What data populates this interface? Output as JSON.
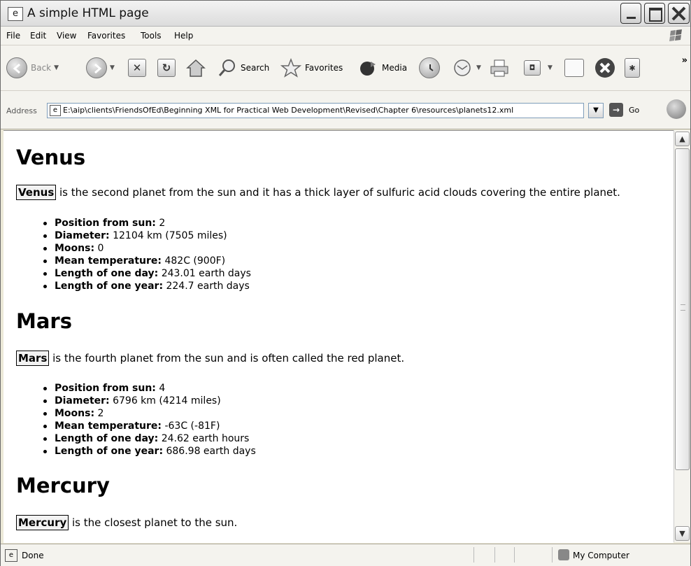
{
  "window": {
    "title": "A simple HTML page"
  },
  "menu": [
    "File",
    "Edit",
    "View",
    "Favorites",
    "Tools",
    "Help"
  ],
  "toolbar": {
    "back": "Back",
    "search": "Search",
    "favorites": "Favorites",
    "media": "Media"
  },
  "address": {
    "label": "Address",
    "url": "E:\\aip\\clients\\FriendsOfEd\\Beginning XML for Practical Web Development\\Revised\\Chapter 6\\resources\\planets12.xml",
    "go": "Go"
  },
  "planets": [
    {
      "heading": "Venus",
      "name": "Venus",
      "description": " is the second planet from the sun and it has a thick layer of sulfuric acid clouds covering the entire planet.",
      "facts": [
        {
          "label": "Position from sun:",
          "value": " 2"
        },
        {
          "label": "Diameter:",
          "value": " 12104 km (7505 miles)"
        },
        {
          "label": "Moons:",
          "value": " 0"
        },
        {
          "label": "Mean temperature:",
          "value": " 482C (900F)"
        },
        {
          "label": "Length of one day:",
          "value": " 243.01 earth days"
        },
        {
          "label": "Length of one year:",
          "value": " 224.7 earth days"
        }
      ]
    },
    {
      "heading": "Mars",
      "name": "Mars",
      "description": " is the fourth planet from the sun and is often called the red planet.",
      "facts": [
        {
          "label": "Position from sun:",
          "value": " 4"
        },
        {
          "label": "Diameter:",
          "value": " 6796 km (4214 miles)"
        },
        {
          "label": "Moons:",
          "value": " 2"
        },
        {
          "label": "Mean temperature:",
          "value": " -63C (-81F)"
        },
        {
          "label": "Length of one day:",
          "value": " 24.62 earth hours"
        },
        {
          "label": "Length of one year:",
          "value": " 686.98 earth days"
        }
      ]
    },
    {
      "heading": "Mercury",
      "name": "Mercury",
      "description": " is the closest planet to the sun."
    }
  ],
  "status": {
    "text": "Done",
    "zone": "My Computer"
  }
}
